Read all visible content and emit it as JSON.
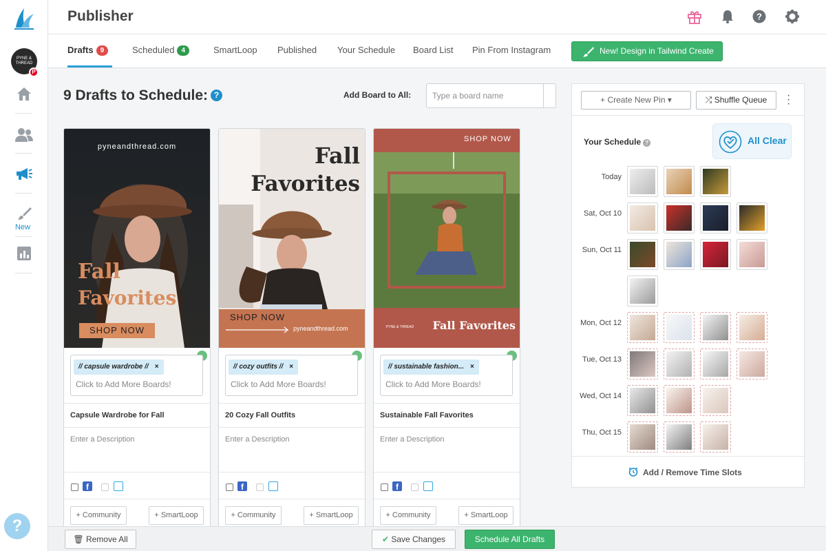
{
  "app": {
    "title": "Publisher"
  },
  "sidebar": {
    "account_initials": "PYNE & THREAD",
    "new_label": "New",
    "items": [
      {
        "name": "home",
        "icon": "home-icon"
      },
      {
        "name": "people",
        "icon": "people-icon"
      },
      {
        "name": "publisher",
        "icon": "megaphone-icon"
      },
      {
        "name": "create",
        "icon": "brush-icon"
      },
      {
        "name": "insights",
        "icon": "chart-icon"
      }
    ],
    "help_glyph": "?"
  },
  "tabs": [
    {
      "label": "Drafts",
      "badge": "9",
      "badge_color": "red"
    },
    {
      "label": "Scheduled",
      "badge": "4",
      "badge_color": "green"
    },
    {
      "label": "SmartLoop"
    },
    {
      "label": "Published"
    },
    {
      "label": "Your Schedule"
    },
    {
      "label": "Board List"
    },
    {
      "label": "Pin From Instagram"
    }
  ],
  "create_button": "New! Design in Tailwind Create",
  "main": {
    "drafts_heading": "9 Drafts to Schedule:",
    "add_board_label": "Add Board to All:",
    "board_placeholder": "Type a board name"
  },
  "cards": [
    {
      "board_chip": "// capsule wardrobe //",
      "add_more": "Click to Add More Boards!",
      "title": "Capsule Wardrobe for Fall",
      "description_placeholder": "Enter a Description",
      "community": "+ Community",
      "smartloop": "+ SmartLoop",
      "img": {
        "brand": "pyneandthread.com",
        "line1": "Fall",
        "line2": "Favorites",
        "cta": "SHOP NOW"
      }
    },
    {
      "board_chip": "// cozy outfits //",
      "add_more": "Click to Add More Boards!",
      "title": "20 Cozy Fall Outfits",
      "description_placeholder": "Enter a Description",
      "community": "+ Community",
      "smartloop": "+ SmartLoop",
      "img": {
        "line1": "Fall",
        "line2": "Favorites",
        "cta": "SHOP NOW",
        "brand": "pyneandthread.com"
      }
    },
    {
      "board_chip": "// sustainable fashion...",
      "add_more": "Click to Add More Boards!",
      "title": "Sustainable Fall Favorites",
      "description_placeholder": "Enter a Description",
      "community": "+ Community",
      "smartloop": "+ SmartLoop",
      "img": {
        "cta": "SHOP NOW",
        "brand": "PYNE & THREAD",
        "line1": "Fall Favorites"
      }
    }
  ],
  "schedule": {
    "create_new_pin": "Create New Pin",
    "shuffle_queue": "Shuffle Queue",
    "title": "Your Schedule",
    "all_clear": "All Clear",
    "days": [
      {
        "label": "Today"
      },
      {
        "label": "Sat, Oct 10"
      },
      {
        "label": "Sun, Oct 11"
      },
      {
        "label": "Mon, Oct 12"
      },
      {
        "label": "Tue, Oct 13"
      },
      {
        "label": "Wed, Oct 14"
      },
      {
        "label": "Thu, Oct 15"
      }
    ],
    "footer": "Add / Remove Time Slots"
  },
  "bottom": {
    "remove_all": "Remove All",
    "save_changes": "Save Changes",
    "schedule_all": "Schedule All Drafts"
  },
  "colors": {
    "accent_blue": "#1f8fcb",
    "green": "#3cb46e",
    "badge_red": "#e04b4b",
    "badge_green": "#2e9a4e"
  }
}
